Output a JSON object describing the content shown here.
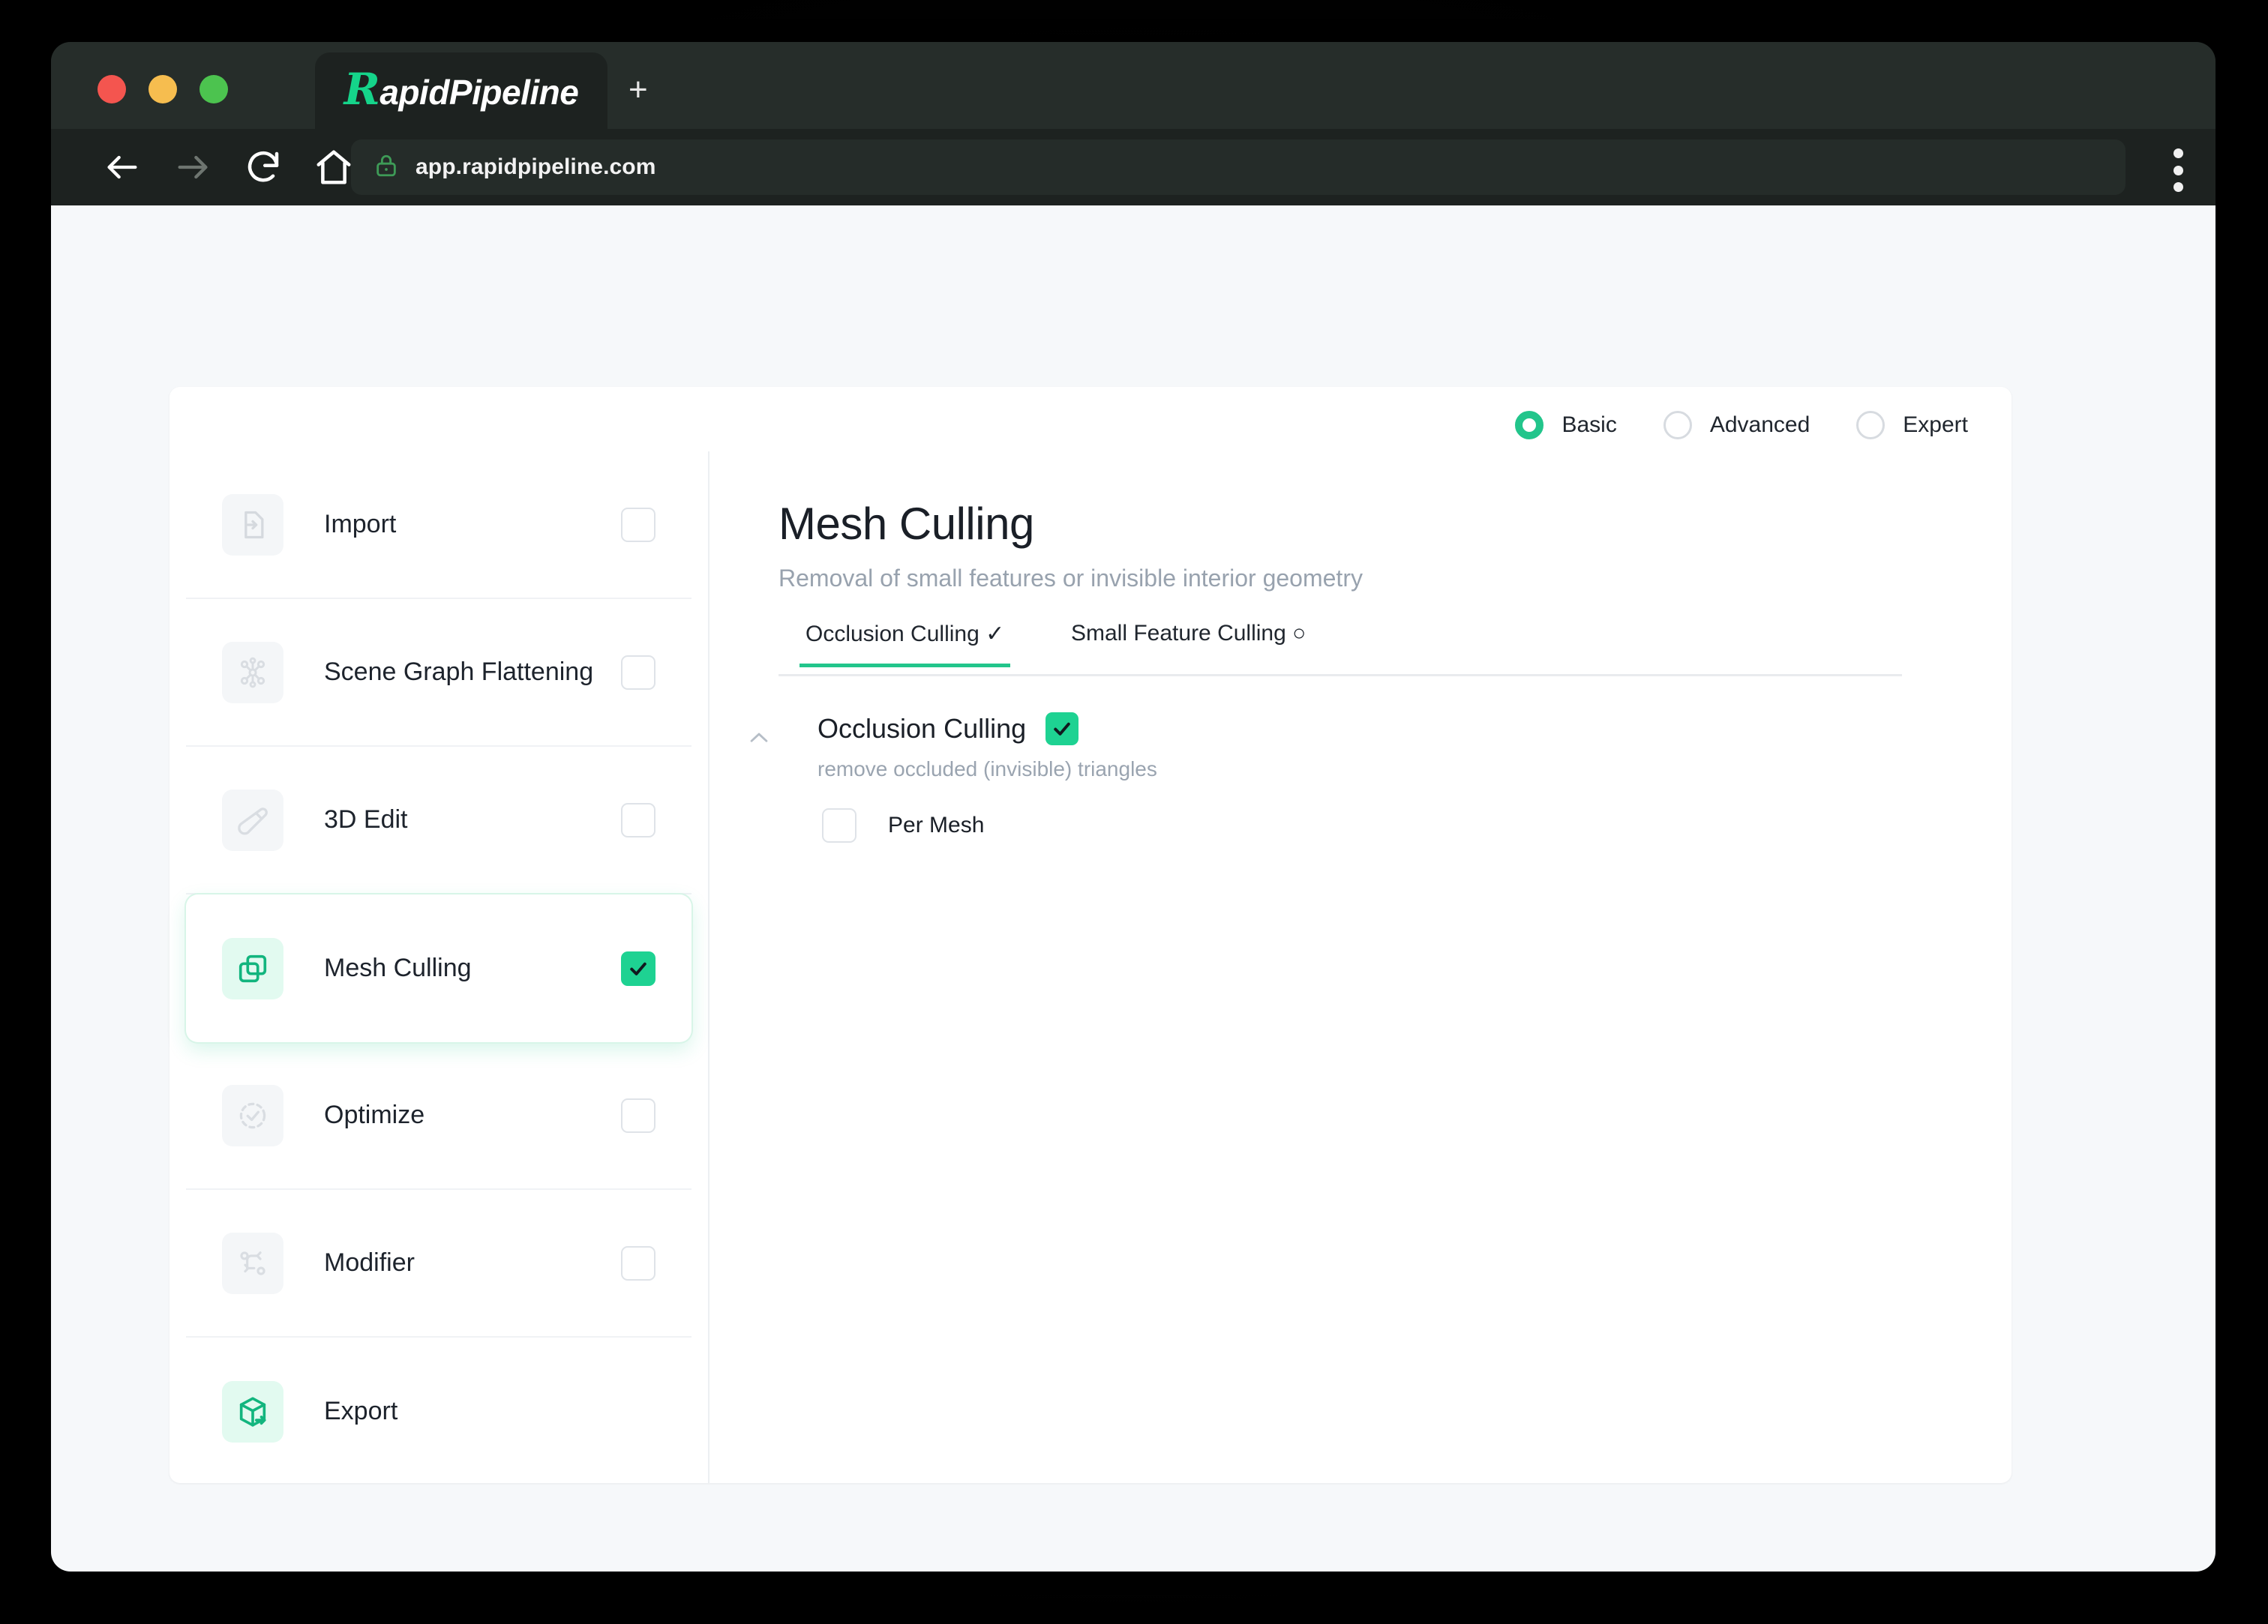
{
  "browser": {
    "tab_title": "RapidPipeline",
    "tab_logo_mark": "R",
    "tab_logo_word": "apidPipeline",
    "new_tab_label": "+",
    "url": "app.rapidpipeline.com",
    "nav": {
      "back": "back-arrow",
      "forward": "forward-arrow",
      "reload": "reload",
      "home": "home",
      "menu": "more-options"
    },
    "window_controls": [
      "close",
      "minimize",
      "maximize"
    ]
  },
  "modes": {
    "options": [
      {
        "label": "Basic",
        "selected": true
      },
      {
        "label": "Advanced",
        "selected": false
      },
      {
        "label": "Expert",
        "selected": false
      }
    ]
  },
  "sidebar": {
    "items": [
      {
        "label": "Import",
        "icon": "import-icon",
        "checked": false,
        "selected": false,
        "has_checkbox": true
      },
      {
        "label": "Scene Graph Flattening",
        "icon": "scene-graph-icon",
        "checked": false,
        "selected": false,
        "has_checkbox": true
      },
      {
        "label": "3D Edit",
        "icon": "edit-icon",
        "checked": false,
        "selected": false,
        "has_checkbox": true
      },
      {
        "label": "Mesh Culling",
        "icon": "mesh-culling-icon",
        "checked": true,
        "selected": true,
        "has_checkbox": true
      },
      {
        "label": "Optimize",
        "icon": "optimize-icon",
        "checked": false,
        "selected": false,
        "has_checkbox": true
      },
      {
        "label": "Modifier",
        "icon": "modifier-icon",
        "checked": false,
        "selected": false,
        "has_checkbox": true
      },
      {
        "label": "Export",
        "icon": "export-icon",
        "checked": false,
        "selected": false,
        "has_checkbox": false
      }
    ]
  },
  "main": {
    "title": "Mesh Culling",
    "subtitle": "Removal of small features or invisible interior geometry",
    "tabs": [
      {
        "label": "Occlusion Culling ✓",
        "active": true
      },
      {
        "label": "Small Feature Culling ○",
        "active": false
      }
    ],
    "option": {
      "title": "Occlusion Culling",
      "enabled": true,
      "description": "remove occluded (invisible) triangles",
      "collapse_icon": "chevron-up-icon",
      "sub_options": [
        {
          "label": "Per Mesh",
          "checked": false
        }
      ]
    }
  },
  "colors": {
    "accent_green": "#22c58b",
    "check_green": "#1ed292",
    "page_bg": "#f6f8fa",
    "card_bg": "#ffffff",
    "chrome_dark": "#1d2220",
    "titlebar_dark": "#262d2a"
  }
}
